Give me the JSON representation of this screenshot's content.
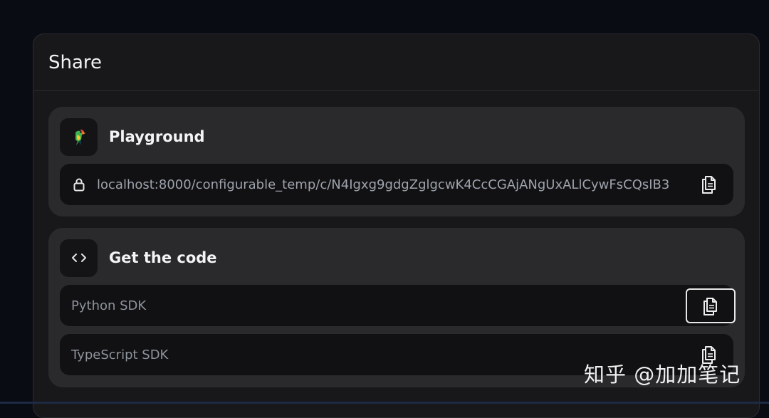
{
  "dialog": {
    "title": "Share"
  },
  "playground": {
    "title": "Playground",
    "icon": "parrot-icon",
    "url": "localhost:8000/configurable_temp/c/N4Igxg9gdgZglgcwK4CcCGAjANgUxALlCywFsCQsIB3"
  },
  "code": {
    "title": "Get the code",
    "icon": "code-icon",
    "items": [
      {
        "label": "Python SDK"
      },
      {
        "label": "TypeScript SDK"
      }
    ]
  },
  "watermark": "知乎 @加加笔记",
  "colors": {
    "background": "#0a0c14",
    "dialog": "#18181b",
    "card": "#2a2a2d",
    "field": "#111113"
  }
}
